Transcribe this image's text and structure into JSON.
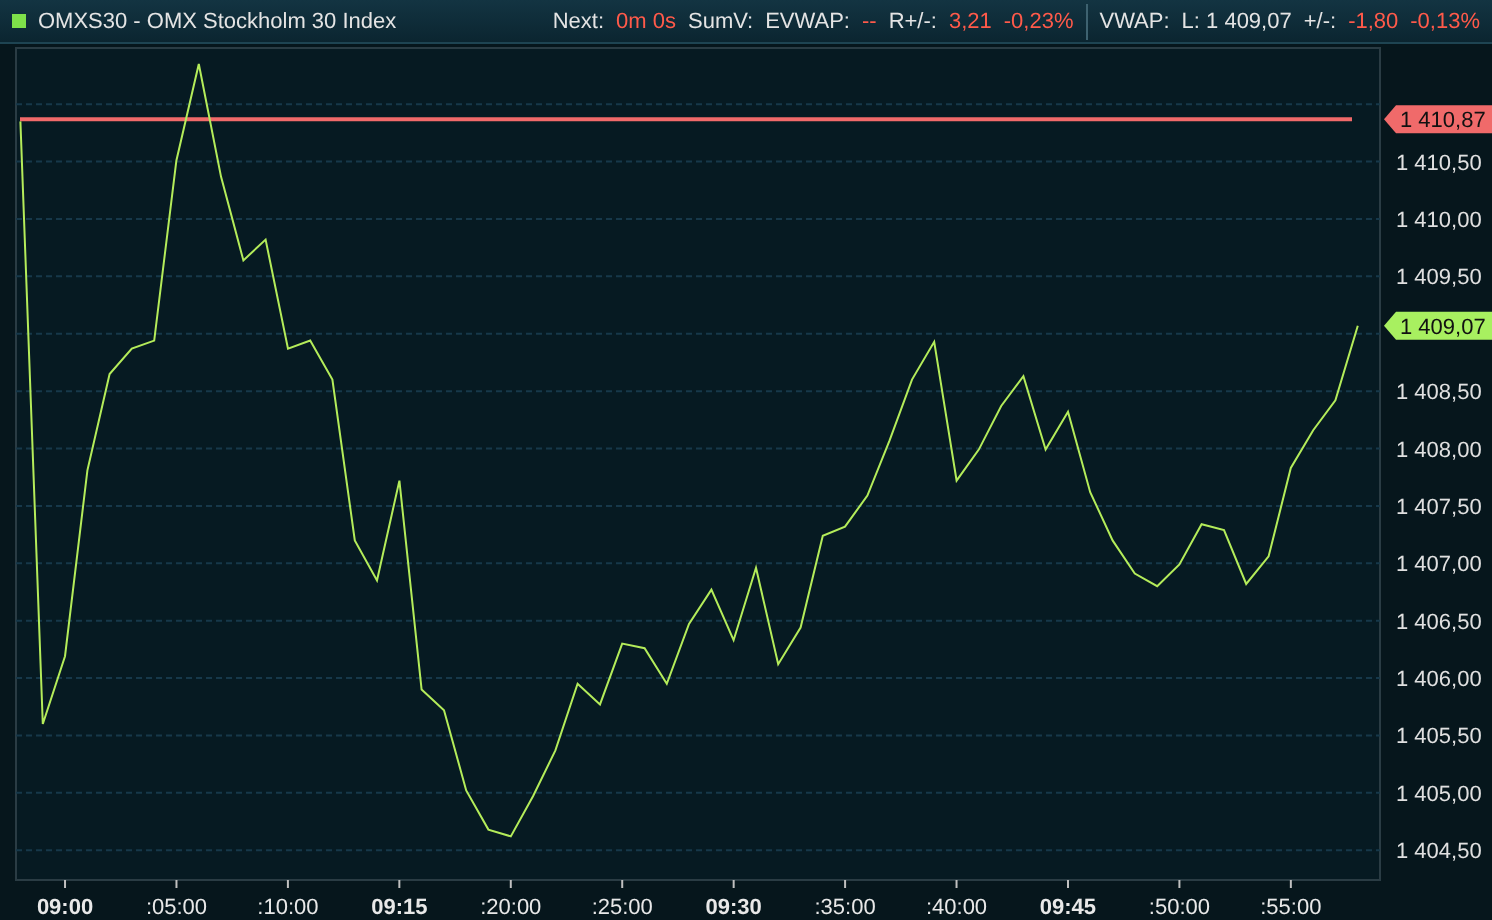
{
  "header": {
    "title": "OMXS30 - OMX Stockholm 30 Index",
    "stats": [
      {
        "kind": "text",
        "text": "Next:",
        "highlight": false
      },
      {
        "kind": "text",
        "text": "0m 0s",
        "highlight": true
      },
      {
        "kind": "text",
        "text": "SumV:",
        "highlight": false
      },
      {
        "kind": "text",
        "text": "EVWAP:",
        "highlight": false
      },
      {
        "kind": "text",
        "text": "--",
        "highlight": true
      },
      {
        "kind": "text",
        "text": "R+/-:",
        "highlight": false
      },
      {
        "kind": "text",
        "text": "3,21",
        "highlight": true
      },
      {
        "kind": "text",
        "text": "-0,23%",
        "highlight": true
      },
      {
        "kind": "divider"
      },
      {
        "kind": "text",
        "text": "VWAP:",
        "highlight": false
      },
      {
        "kind": "text",
        "text": "L: 1 409,07",
        "highlight": false
      },
      {
        "kind": "text",
        "text": "+/-:",
        "highlight": false
      },
      {
        "kind": "text",
        "text": "-1,80",
        "highlight": true
      },
      {
        "kind": "text",
        "text": "-0,13%",
        "highlight": true
      }
    ]
  },
  "chart_data": {
    "type": "line",
    "categories": [
      null,
      null,
      "09:00",
      null,
      null,
      null,
      null,
      ":05:00",
      null,
      null,
      null,
      null,
      ":10:00",
      null,
      null,
      null,
      null,
      "09:15",
      null,
      null,
      null,
      null,
      ":20:00",
      null,
      null,
      null,
      null,
      ":25:00",
      null,
      null,
      null,
      null,
      "09:30",
      null,
      null,
      null,
      null,
      ":35:00",
      null,
      null,
      null,
      null,
      ":40:00",
      null,
      null,
      null,
      null,
      "09:45",
      null,
      null,
      null,
      null,
      ":50:00",
      null,
      null,
      null,
      null,
      ":55:00",
      null,
      null,
      null
    ],
    "grid": true,
    "series": [
      {
        "color": "#b4ec5a",
        "values": [
          1410.85,
          1405.6,
          1406.19,
          1407.81,
          1408.65,
          1408.87,
          1408.94,
          1410.51,
          1411.35,
          1410.37,
          1409.64,
          1409.82,
          1408.87,
          1408.94,
          1408.6,
          1407.2,
          1406.85,
          1407.72,
          1405.9,
          1405.72,
          1405.02,
          1404.68,
          1404.62,
          1404.97,
          1405.37,
          1405.95,
          1405.77,
          1406.3,
          1406.26,
          1405.95,
          1406.47,
          1406.77,
          1406.33,
          1406.96,
          1406.12,
          1406.44,
          1407.24,
          1407.32,
          1407.59,
          1408.07,
          1408.6,
          1408.93,
          1407.72,
          1407.99,
          1408.37,
          1408.63,
          1407.99,
          1408.32,
          1407.62,
          1407.2,
          1406.91,
          1406.8,
          1406.99,
          1407.34,
          1407.29,
          1406.82,
          1407.06,
          1407.83,
          1408.16,
          1408.42,
          1409.07
        ]
      }
    ],
    "ylim": [
      1404.24,
      1411.49
    ],
    "yticks": [
      {
        "value": 1410.5,
        "label": "1 410,50"
      },
      {
        "value": 1410,
        "label": "1 410,00"
      },
      {
        "value": 1409.5,
        "label": "1 409,50"
      },
      {
        "value": 1408.5,
        "label": "1 408,50"
      },
      {
        "value": 1408,
        "label": "1 408,00"
      },
      {
        "value": 1407.5,
        "label": "1 407,50"
      },
      {
        "value": 1407,
        "label": "1 407,00"
      },
      {
        "value": 1406.5,
        "label": "1 406,50"
      },
      {
        "value": 1406,
        "label": "1 406,00"
      },
      {
        "value": 1405.5,
        "label": "1 405,50"
      },
      {
        "value": 1405,
        "label": "1 405,00"
      },
      {
        "value": 1404.5,
        "label": "1 404,50"
      }
    ],
    "ref_lines": [
      {
        "axis": "y",
        "value": 1410.87,
        "label": "1 410,87",
        "color": "#f06a6a"
      }
    ],
    "annotations": [
      "1 409,07"
    ]
  }
}
